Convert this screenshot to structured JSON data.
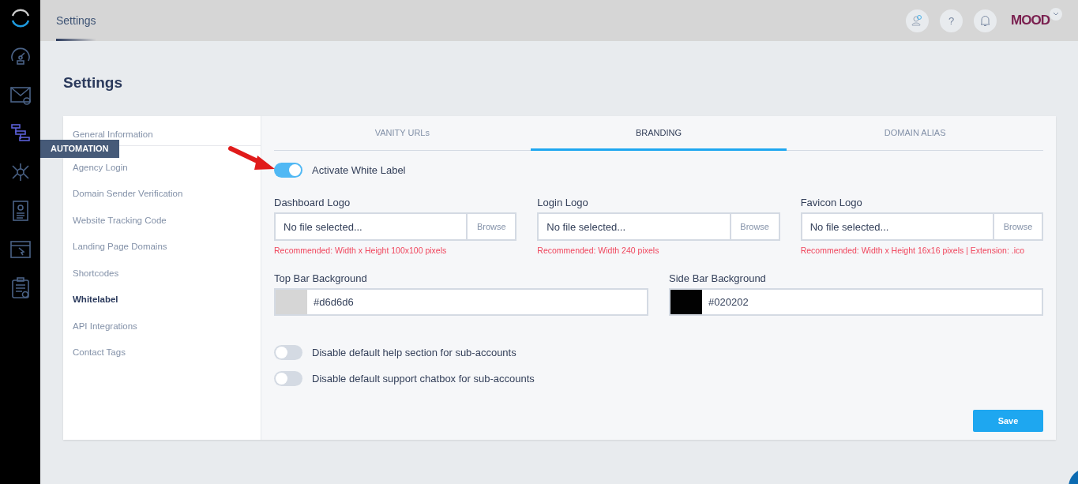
{
  "sidebar": {
    "items": [
      {
        "selected": false
      },
      {
        "selected": false
      },
      {
        "selected": true
      },
      {
        "selected": false
      },
      {
        "selected": false
      },
      {
        "selected": false
      },
      {
        "selected": false
      }
    ],
    "tooltip": "AUTOMATION"
  },
  "top_bar": {
    "tabs": [
      {
        "label": "Settings",
        "selected": true
      }
    ],
    "brand_logo": "MOOD",
    "help": "?"
  },
  "page_title": "Settings",
  "settings_menu": [
    {
      "label": "General Information",
      "selected": false
    },
    {
      "label": "Agency Login",
      "selected": false
    },
    {
      "label": "Domain Sender Verification",
      "selected": false
    },
    {
      "label": "Website Tracking Code",
      "selected": false
    },
    {
      "label": "Landing Page Domains",
      "selected": false
    },
    {
      "label": "Shortcodes",
      "selected": false
    },
    {
      "label": "Whitelabel",
      "selected": true
    },
    {
      "label": "API Integrations",
      "selected": false
    },
    {
      "label": "Contact Tags",
      "selected": false
    }
  ],
  "tabs": [
    {
      "label": "VANITY URLs",
      "selected": false
    },
    {
      "label": "BRANDING",
      "selected": true
    },
    {
      "label": "DOMAIN ALIAS",
      "selected": false
    }
  ],
  "activate_toggle": {
    "label": "Activate White Label",
    "on": true
  },
  "logo_uploads": [
    {
      "label": "Dashboard Logo",
      "placeholder": "No file selected...",
      "button": "Browse",
      "hint": "Recommended: Width x Height 100x100 pixels"
    },
    {
      "label": "Login Logo",
      "placeholder": "No file selected...",
      "button": "Browse",
      "hint": "Recommended: Width 240 pixels"
    },
    {
      "label": "Favicon Logo",
      "placeholder": "No file selected...",
      "button": "Browse",
      "hint": "Recommended: Width x Height 16x16 pixels | Extension: .ico"
    }
  ],
  "color_fields": [
    {
      "label": "Top Bar Background",
      "value": "#d6d6d6",
      "color": "#d6d6d6"
    },
    {
      "label": "Side Bar Background",
      "value": "#020202",
      "color": "#020202"
    }
  ],
  "option_toggles": [
    {
      "label": "Disable default help section for sub-accounts",
      "on": false
    },
    {
      "label": "Disable default support chatbox for sub-accounts",
      "on": false
    }
  ],
  "save_button": "Save"
}
